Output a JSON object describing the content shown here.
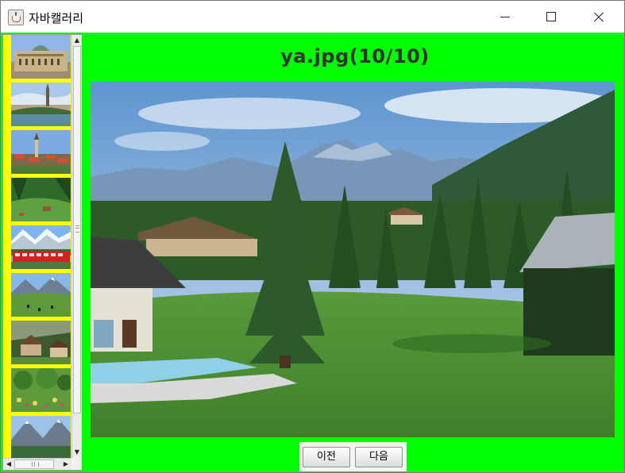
{
  "window": {
    "title": "자바캘러리"
  },
  "viewer": {
    "image_title": "ya.jpg(10/10)"
  },
  "buttons": {
    "prev_label": "이전",
    "next_label": "다음"
  },
  "thumbnails": [
    {
      "alt": "palace"
    },
    {
      "alt": "river-town"
    },
    {
      "alt": "church-village"
    },
    {
      "alt": "green-valley"
    },
    {
      "alt": "red-train"
    },
    {
      "alt": "alpine-meadow"
    },
    {
      "alt": "chalet-houses"
    },
    {
      "alt": "garden"
    },
    {
      "alt": "mountain-lake"
    }
  ],
  "colors": {
    "background": "#00ff00",
    "thumbnail_panel": "#ffff00",
    "title_text": "#333333"
  }
}
